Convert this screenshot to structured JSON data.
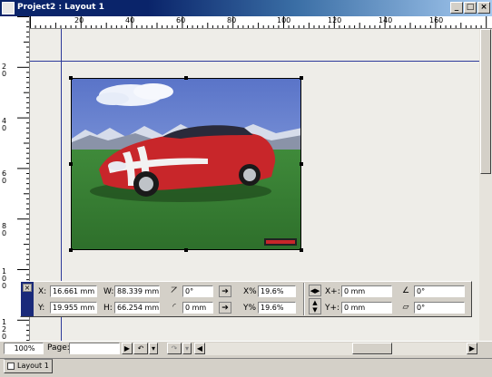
{
  "window": {
    "title": "Project2 : Layout 1",
    "minimize_glyph": "_",
    "maximize_glyph": "□",
    "close_glyph": "×"
  },
  "rulers": {
    "horizontal_ticks": [
      "20",
      "40",
      "60",
      "80",
      "100",
      "120",
      "140",
      "160"
    ],
    "vertical_ticks": [
      "2\n0",
      "4\n0",
      "6\n0",
      "8\n0",
      "1\n0\n0",
      "1\n2\n0"
    ]
  },
  "measurements": {
    "x_label": "X:",
    "x_value": "16.661 mm",
    "y_label": "Y:",
    "y_value": "19.955 mm",
    "w_label": "W:",
    "w_value": "88.339 mm",
    "h_label": "H:",
    "h_value": "66.254 mm",
    "rotation_value": "0°",
    "corner_radius_value": "0 mm",
    "scale_x_label": "X%",
    "scale_x_value": "19.6%",
    "scale_y_label": "Y%",
    "scale_y_value": "19.6%",
    "offset_x_label": "X+:",
    "offset_x_value": "0 mm",
    "offset_y_label": "Y+:",
    "offset_y_value": "0 mm",
    "picture_angle_value": "0°",
    "picture_skew_value": "0°"
  },
  "statusbar": {
    "zoom": "100%",
    "page_label": "Page:",
    "page_value": ""
  },
  "tabs": [
    {
      "label": "Layout 1"
    }
  ],
  "colors": {
    "title_active": "#0a246a",
    "guide": "#2d3a9a",
    "car_red": "#c8262a"
  }
}
